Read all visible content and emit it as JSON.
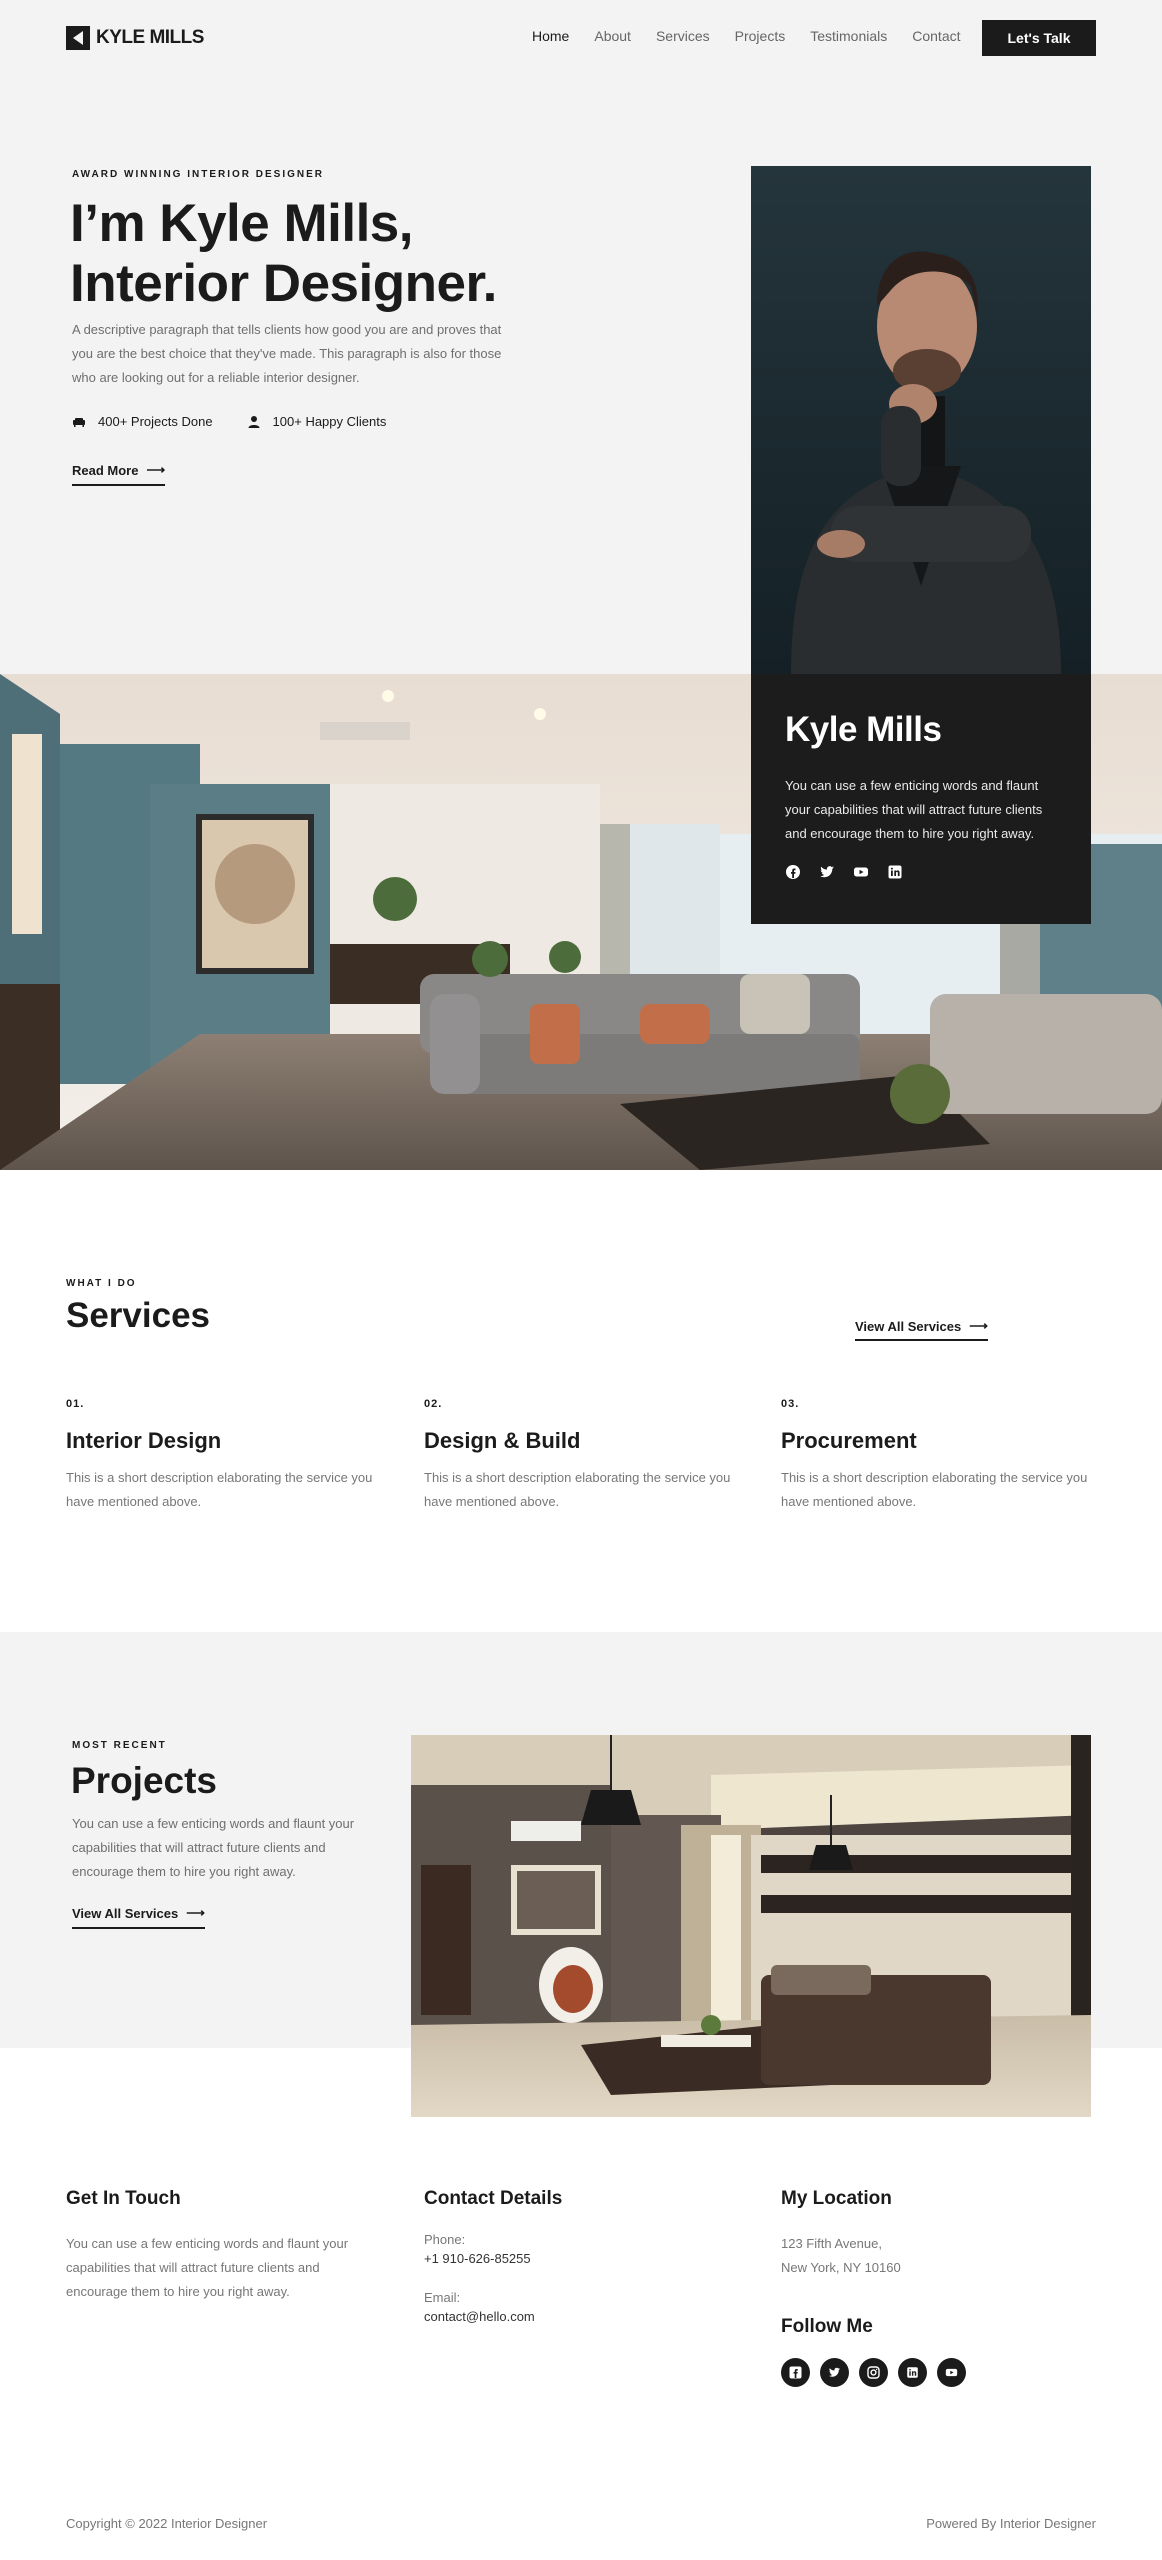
{
  "brand": {
    "name": "KYLE MILLS"
  },
  "nav": {
    "items": [
      "Home",
      "About",
      "Services",
      "Projects",
      "Testimonials",
      "Contact"
    ],
    "active": "Home",
    "cta": "Let's Talk"
  },
  "hero": {
    "eyebrow": "AWARD WINNING INTERIOR DESIGNER",
    "title_line1": "I’m Kyle Mills,",
    "title_line2": "Interior Designer.",
    "description": "A descriptive paragraph that tells clients how good you are and proves that you are the best choice that they've made. This paragraph is also for those who are looking out for a reliable interior designer.",
    "stats": [
      {
        "icon": "sofa-icon",
        "label": "400+ Projects Done"
      },
      {
        "icon": "user-icon",
        "label": "100+ Happy Clients"
      }
    ],
    "read_more": "Read More"
  },
  "profile_card": {
    "name": "Kyle Mills",
    "text": "You can use a few enticing words and flaunt your capabilities that will attract future clients and encourage them to hire you right away.",
    "socials": [
      "facebook-icon",
      "twitter-icon",
      "youtube-icon",
      "linkedin-icon"
    ]
  },
  "services": {
    "eyebrow": "WHAT I DO",
    "title": "Services",
    "view_all": "View All Services",
    "items": [
      {
        "num": "01.",
        "title": "Interior Design",
        "text": "This is a short description elaborating the service you have mentioned above."
      },
      {
        "num": "02.",
        "title": "Design & Build",
        "text": "This is a short description elaborating the service you have mentioned above."
      },
      {
        "num": "03.",
        "title": "Procurement",
        "text": "This is a short description elaborating the service you have mentioned above."
      }
    ]
  },
  "projects": {
    "eyebrow": "MOST RECENT",
    "title": "Projects",
    "text": "You can use a few enticing words and flaunt your capabilities that will attract future clients and encourage them to hire you right away.",
    "view_all": "View All Services"
  },
  "footer": {
    "get_in_touch": {
      "title": "Get In Touch",
      "text": "You can use a few enticing words and flaunt your capabilities that will attract future clients and encourage them to hire you right away."
    },
    "contact": {
      "title": "Contact Details",
      "phone_label": "Phone:",
      "phone": "+1 910-626-85255",
      "email_label": "Email:",
      "email": "contact@hello.com"
    },
    "location": {
      "title": "My Location",
      "line1": "123 Fifth Avenue,",
      "line2": "New York, NY 10160"
    },
    "follow": {
      "title": "Follow Me",
      "socials": [
        "facebook-icon",
        "twitter-icon",
        "instagram-icon",
        "linkedin-icon",
        "youtube-icon"
      ]
    },
    "copyright": "Copyright © 2022 Interior Designer",
    "powered": "Powered By Interior Designer"
  }
}
